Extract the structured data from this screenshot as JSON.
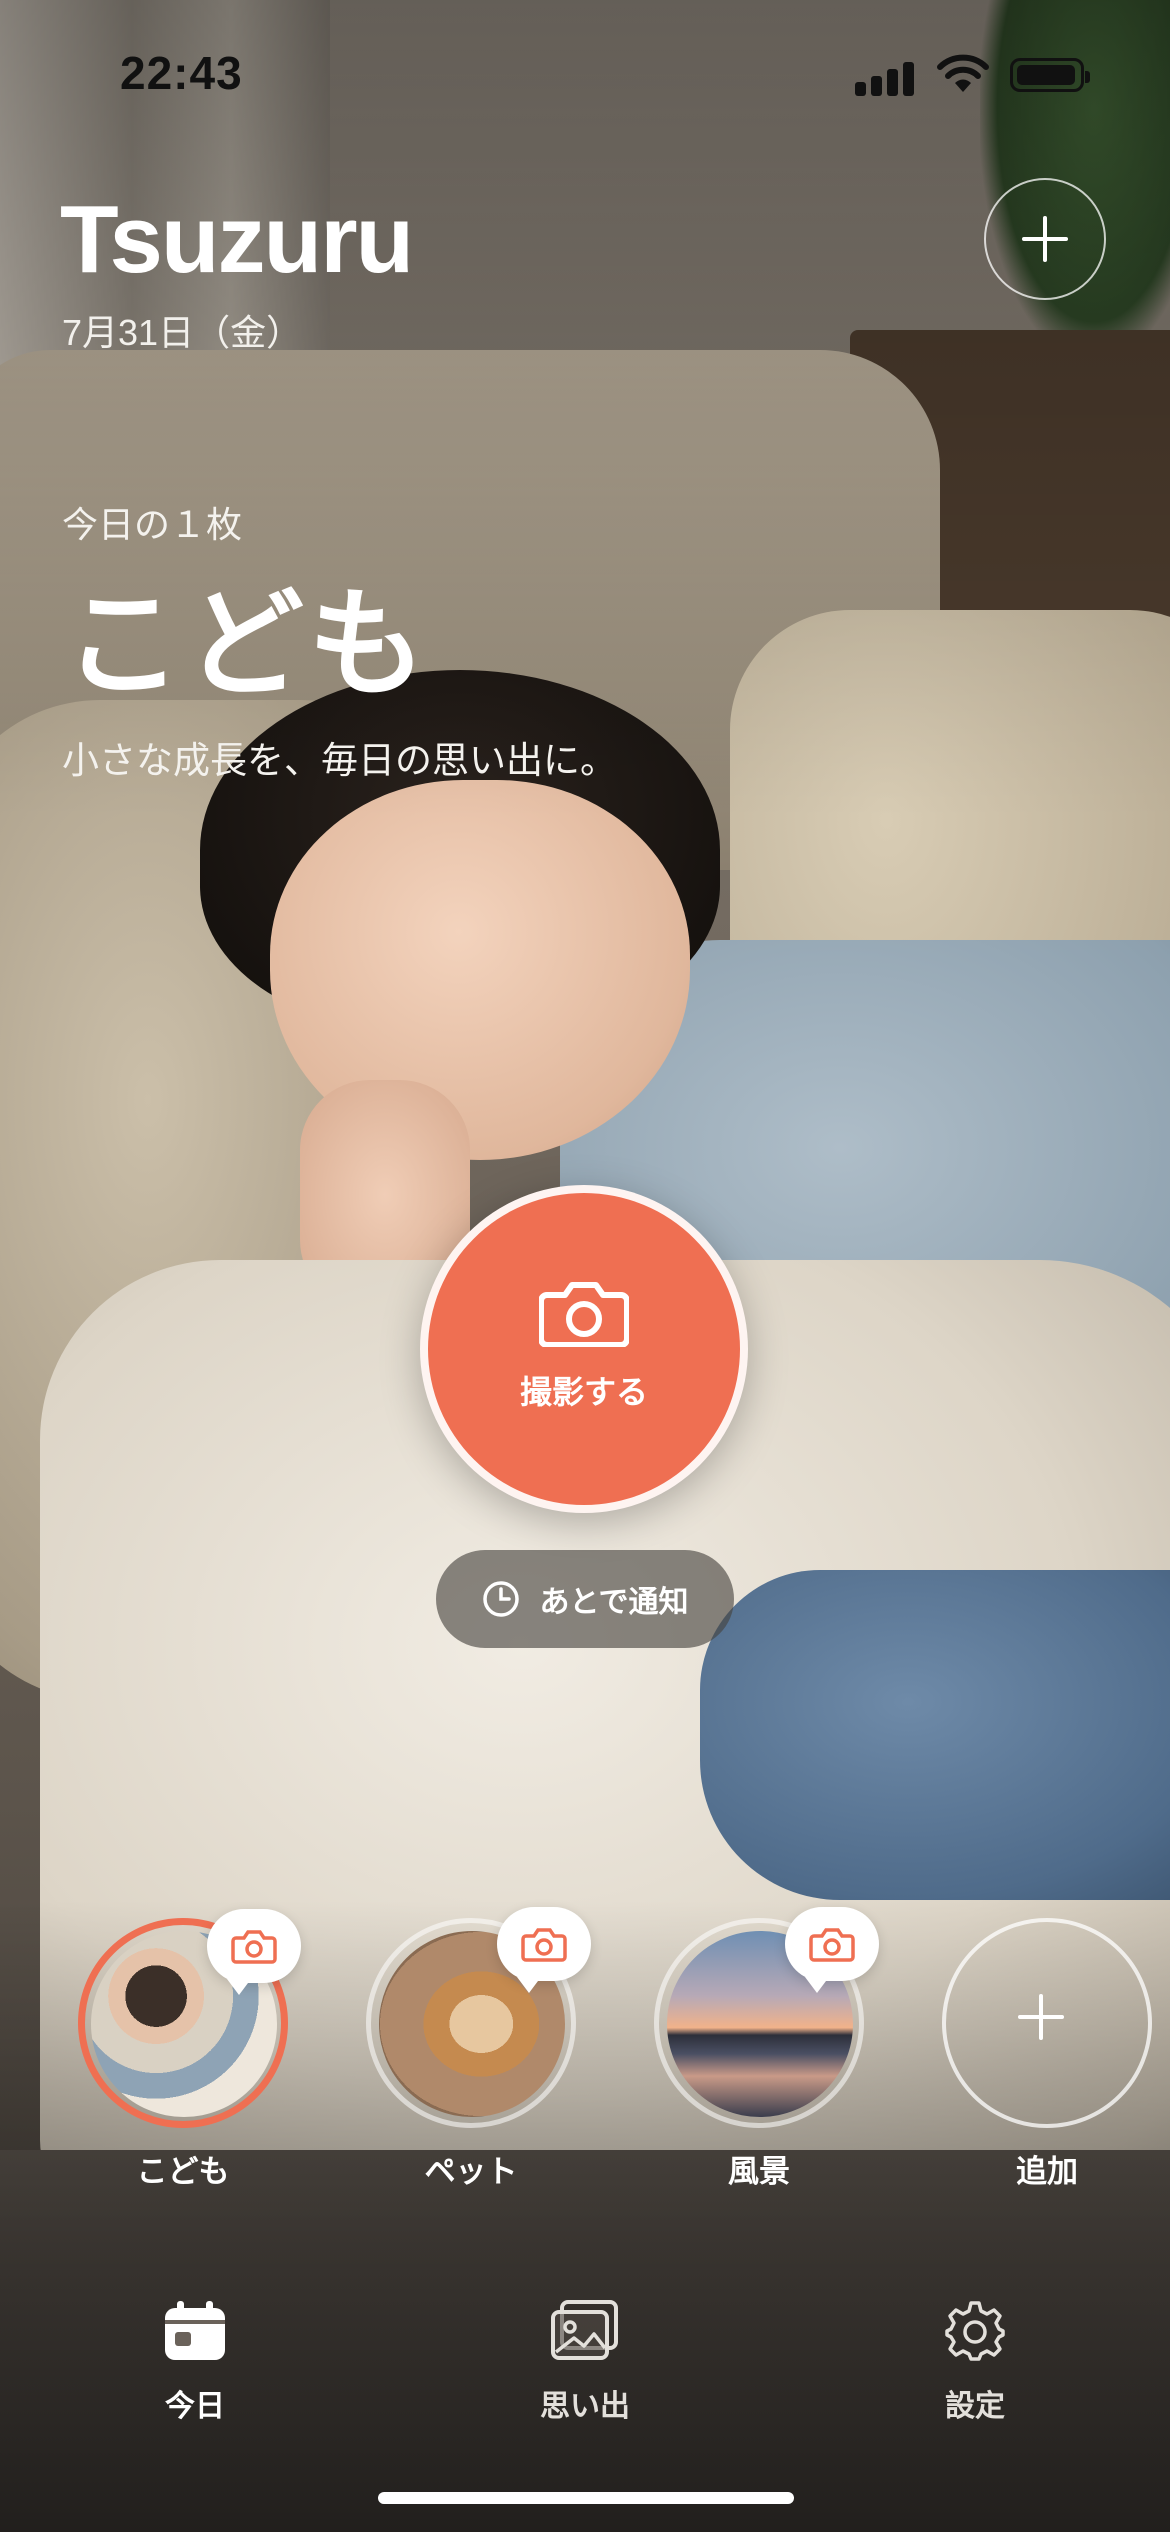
{
  "status_bar": {
    "time": "22:43"
  },
  "header": {
    "app_title": "Tsuzuru",
    "date": "7月31日（金）"
  },
  "today": {
    "label": "今日の１枚",
    "category": "こども",
    "tagline": "小さな成長を、毎日の思い出に。"
  },
  "actions": {
    "capture_label": "撮影する",
    "remind_later_label": "あとで通知"
  },
  "categories": [
    {
      "name": "こども",
      "selected": true
    },
    {
      "name": "ペット",
      "selected": false
    },
    {
      "name": "風景",
      "selected": false
    },
    {
      "name": "追加",
      "selected": false
    }
  ],
  "tabs": [
    {
      "label": "今日",
      "icon": "calendar-icon",
      "active": true
    },
    {
      "label": "思い出",
      "icon": "photos-icon",
      "active": false
    },
    {
      "label": "設定",
      "icon": "gear-icon",
      "active": false
    }
  ],
  "colors": {
    "accent": "#ef6f52",
    "text_primary": "#ffffff",
    "tab_inactive": "#e3e0db"
  }
}
